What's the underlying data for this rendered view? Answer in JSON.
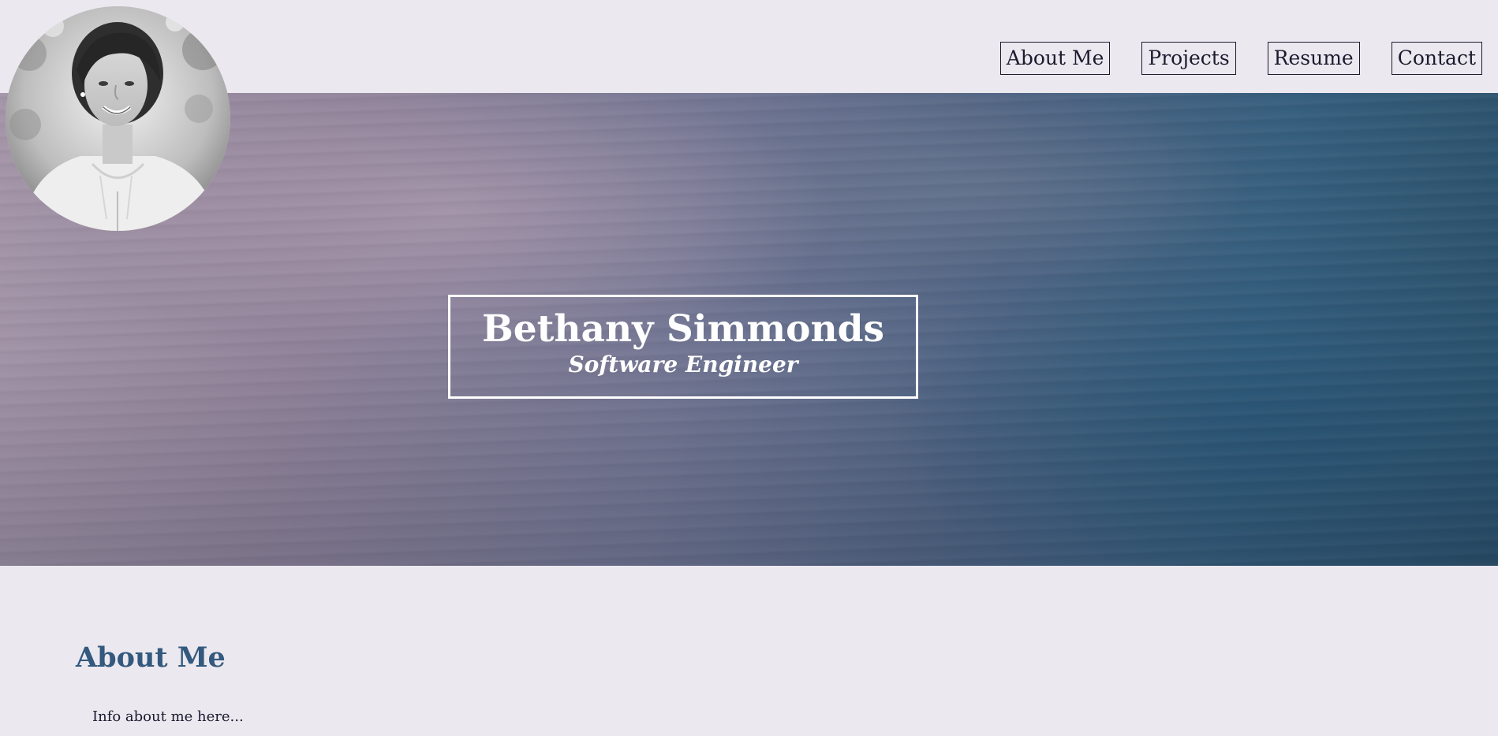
{
  "nav": {
    "items": [
      {
        "label": "About Me"
      },
      {
        "label": "Projects"
      },
      {
        "label": "Resume"
      },
      {
        "label": "Contact"
      }
    ]
  },
  "hero": {
    "name": "Bethany Simmonds",
    "role": "Software Engineer"
  },
  "about": {
    "title": "About Me",
    "text": "Info about me here..."
  },
  "colors": {
    "page_background": "#ebe8ef",
    "nav_text": "#1b1b2e",
    "section_heading": "#33597e",
    "hero_text": "#ffffff"
  }
}
